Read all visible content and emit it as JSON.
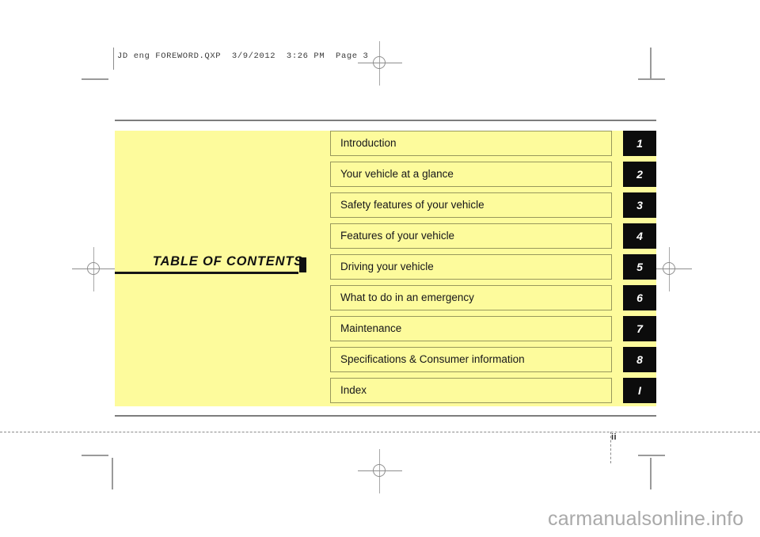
{
  "print_header": {
    "text": "JD eng FOREWORD.QXP  3/9/2012  3:26 PM  Page 3"
  },
  "page": {
    "folio": "ii",
    "watermark": "carmanualsonline.info",
    "panel_color": "#fdfb9c",
    "tab_color": "#0c0c0c",
    "item_border_color": "#98985c"
  },
  "toc": {
    "heading": "TABLE  OF  CONTENTS",
    "items": [
      {
        "label": "Introduction",
        "tab": "1"
      },
      {
        "label": "Your vehicle at a glance",
        "tab": "2"
      },
      {
        "label": "Safety features of your vehicle",
        "tab": "3"
      },
      {
        "label": "Features of your vehicle",
        "tab": "4"
      },
      {
        "label": "Driving your vehicle",
        "tab": "5"
      },
      {
        "label": "What to do in an emergency",
        "tab": "6"
      },
      {
        "label": "Maintenance",
        "tab": "7"
      },
      {
        "label": "Specifications & Consumer information",
        "tab": "8"
      },
      {
        "label": "Index",
        "tab": "I"
      }
    ]
  }
}
